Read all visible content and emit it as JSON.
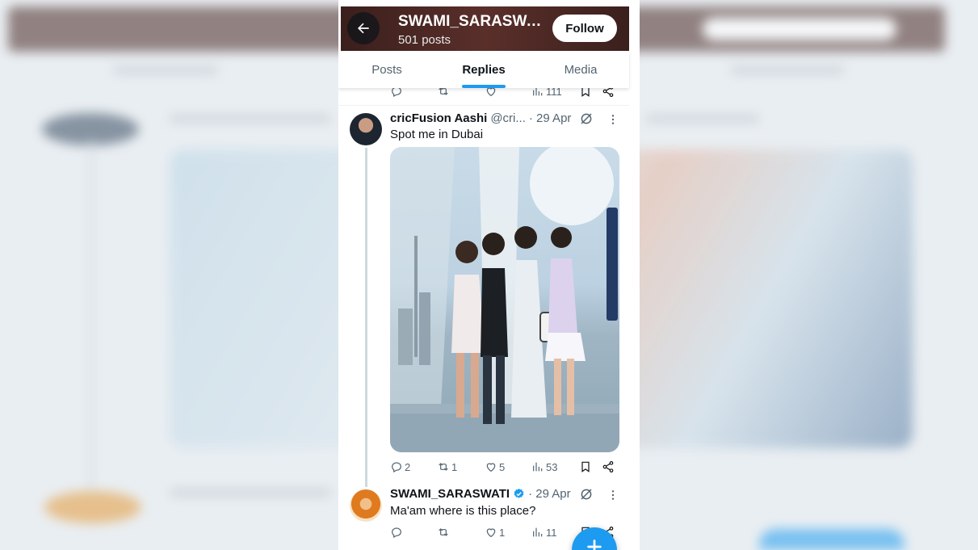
{
  "header": {
    "profile_name": "SWAMI_SARASWATI",
    "post_count": "501 posts",
    "follow_label": "Follow"
  },
  "tabs": [
    {
      "label": "Posts",
      "active": false
    },
    {
      "label": "Replies",
      "active": true
    },
    {
      "label": "Media",
      "active": false
    }
  ],
  "previous_tweet": {
    "views": "111"
  },
  "tweet_main": {
    "author_name": "cricFusion Aashi",
    "handle": "@cri...",
    "date": "· 29 Apr",
    "text": "Spot me in Dubai",
    "replies": "2",
    "reposts": "1",
    "likes": "5",
    "views": "53"
  },
  "tweet_reply": {
    "author_name": "SWAMI_SARASWATI",
    "date": "· 29 Apr",
    "text": "Ma'am where is this place?",
    "replies": "",
    "reposts": "",
    "likes": "1",
    "views": "11"
  },
  "colors": {
    "accent": "#1d9bf0",
    "text_primary": "#0f1419",
    "text_secondary": "#536471",
    "header_bg": "#4a2724"
  },
  "icons": [
    "back-arrow-icon",
    "reply-icon",
    "repost-icon",
    "like-icon",
    "views-icon",
    "bookmark-icon",
    "share-icon",
    "grok-icon",
    "more-icon",
    "verified-icon",
    "compose-icon"
  ]
}
